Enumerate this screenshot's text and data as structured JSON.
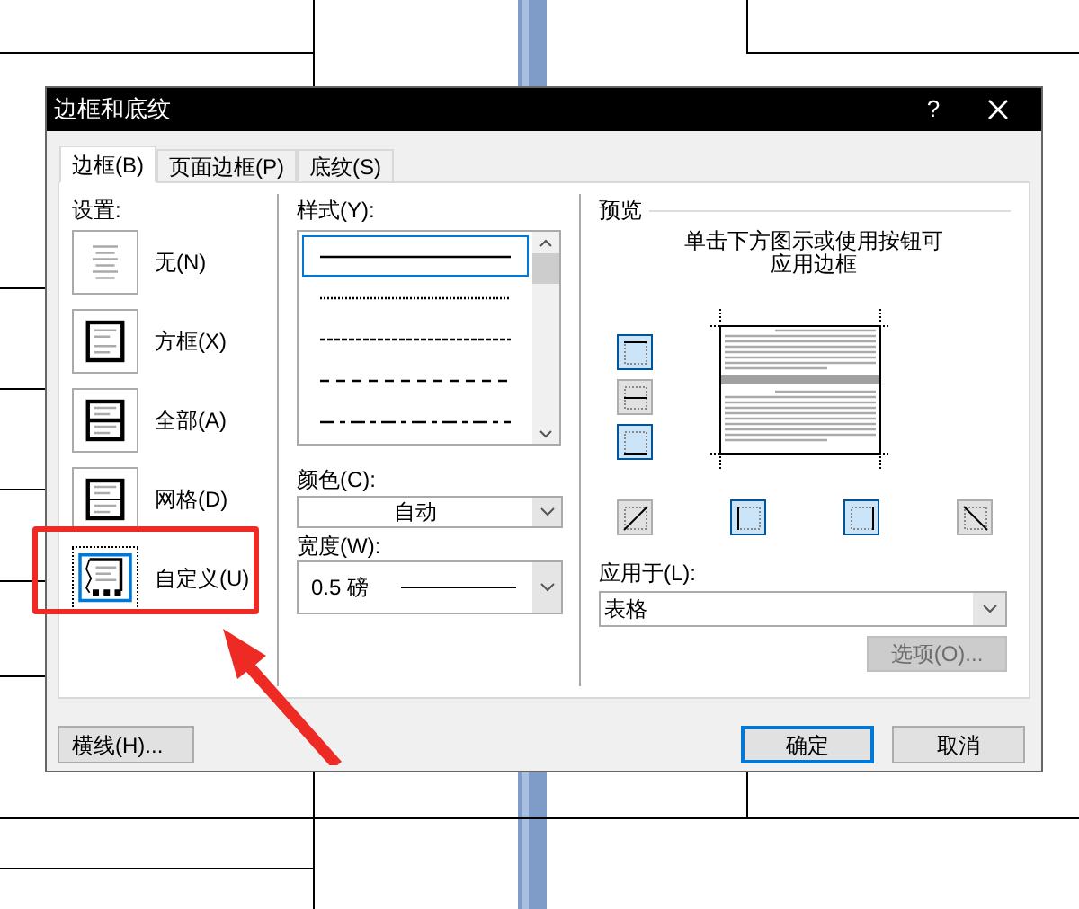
{
  "window": {
    "title": "边框和底纹",
    "help": "?"
  },
  "tabs": [
    {
      "label": "边框(B)",
      "selected": true
    },
    {
      "label": "页面边框(P)",
      "selected": false
    },
    {
      "label": "底纹(S)",
      "selected": false
    }
  ],
  "settings": {
    "label": "设置:",
    "items": [
      {
        "label": "无(N)",
        "kind": "none",
        "selected": false
      },
      {
        "label": "方框(X)",
        "kind": "box",
        "selected": false
      },
      {
        "label": "全部(A)",
        "kind": "all",
        "selected": false
      },
      {
        "label": "网格(D)",
        "kind": "grid",
        "selected": false
      },
      {
        "label": "自定义(U)",
        "kind": "custom",
        "selected": true
      }
    ]
  },
  "style": {
    "label": "样式(Y):",
    "lines": [
      {
        "kind": "solid",
        "selected": true
      },
      {
        "kind": "dotted",
        "selected": false
      },
      {
        "kind": "fine-dash",
        "selected": false
      },
      {
        "kind": "dashed",
        "selected": false
      },
      {
        "kind": "dash-dot",
        "selected": false
      }
    ]
  },
  "color": {
    "label": "颜色(C):",
    "value": "自动"
  },
  "width": {
    "label": "宽度(W):",
    "value": "0.5 磅"
  },
  "preview": {
    "label": "预览",
    "hint_lines": [
      "单击下方图示或使用按钮可",
      "应用边框"
    ],
    "side_buttons": [
      {
        "kind": "top",
        "selected": true
      },
      {
        "kind": "inside-h",
        "selected": false
      },
      {
        "kind": "bottom",
        "selected": true
      }
    ],
    "bottom_buttons": [
      {
        "kind": "diag-up",
        "selected": false
      },
      {
        "kind": "left",
        "selected": true
      },
      {
        "kind": "right",
        "selected": true
      },
      {
        "kind": "diag-down",
        "selected": false
      }
    ]
  },
  "apply_to": {
    "label": "应用于(L):",
    "value": "表格"
  },
  "options_button": {
    "label": "选项(O)...",
    "disabled": true
  },
  "horizontal_line_button": {
    "label": "横线(H)..."
  },
  "ok_button": {
    "label": "确定"
  },
  "cancel_button": {
    "label": "取消"
  }
}
